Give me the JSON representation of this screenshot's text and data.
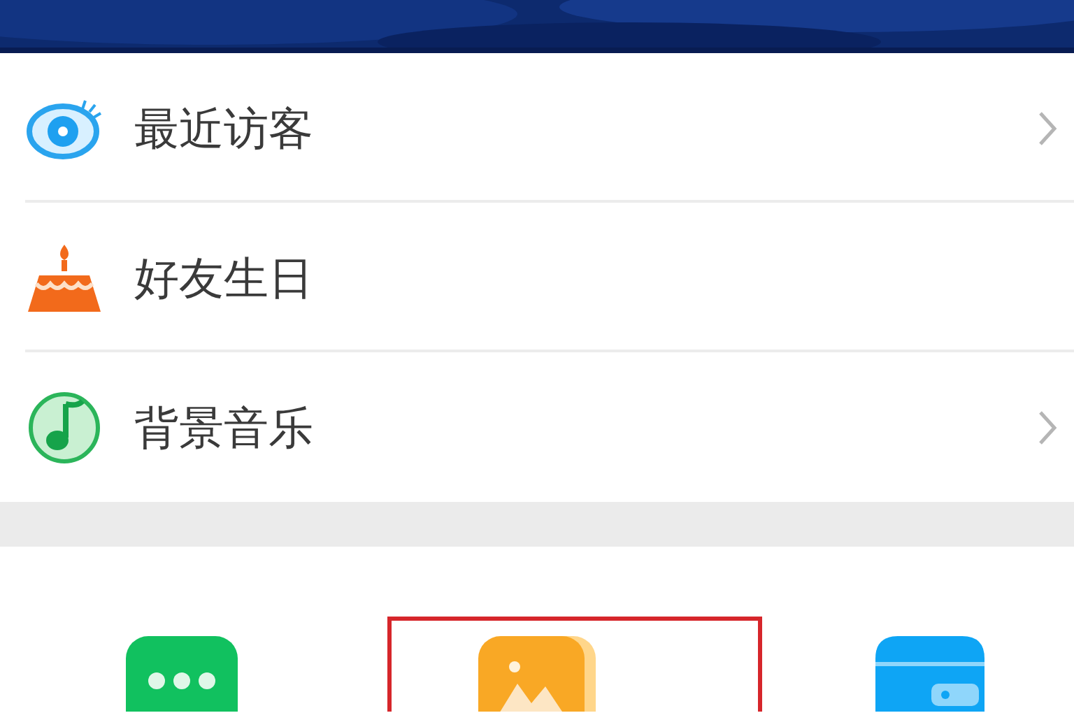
{
  "menu_items": [
    {
      "kind": "visitors",
      "label": "最近访客",
      "chevron": true
    },
    {
      "kind": "birthday",
      "label": "好友生日",
      "chevron": false
    },
    {
      "kind": "music",
      "label": "背景音乐",
      "chevron": true
    }
  ],
  "shortcuts": [
    {
      "kind": "chat",
      "highlighted": false
    },
    {
      "kind": "album",
      "highlighted": true
    },
    {
      "kind": "wallet",
      "highlighted": false
    }
  ]
}
